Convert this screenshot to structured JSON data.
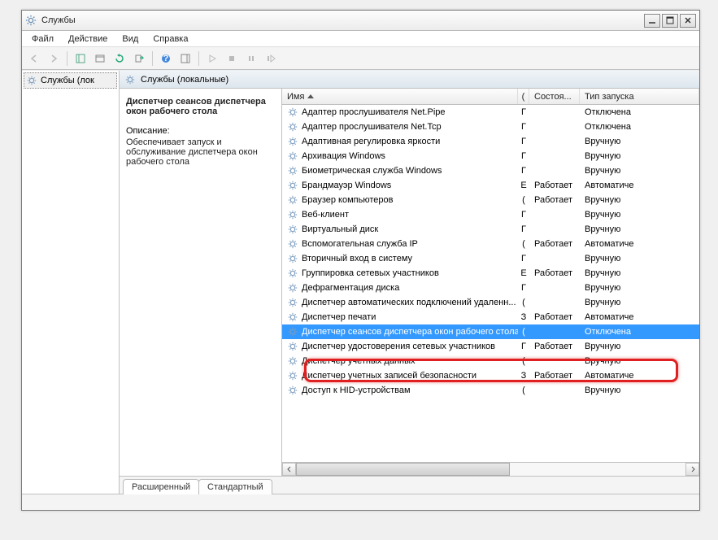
{
  "window": {
    "title": "Службы"
  },
  "menu": {
    "file": "Файл",
    "action": "Действие",
    "view": "Вид",
    "help": "Справка"
  },
  "nav": {
    "services_local_short": "Службы (лок"
  },
  "main": {
    "header": "Службы (локальные)",
    "selected_name": "Диспетчер сеансов диспетчера окон рабочего стола",
    "desc_label": "Описание:",
    "desc_text": "Обеспечивает запуск и обслуживание диспетчера окон рабочего стола"
  },
  "columns": {
    "name": "Имя",
    "desc": "(",
    "state": "Состоя...",
    "startup": "Тип запуска"
  },
  "services": [
    {
      "name": "Адаптер прослушивателя Net.Pipe",
      "d": "Г",
      "state": "",
      "startup": "Отключена"
    },
    {
      "name": "Адаптер прослушивателя Net.Tcp",
      "d": "Г",
      "state": "",
      "startup": "Отключена"
    },
    {
      "name": "Адаптивная регулировка яркости",
      "d": "Г",
      "state": "",
      "startup": "Вручную"
    },
    {
      "name": "Архивация Windows",
      "d": "Г",
      "state": "",
      "startup": "Вручную"
    },
    {
      "name": "Биометрическая служба Windows",
      "d": "Г",
      "state": "",
      "startup": "Вручную"
    },
    {
      "name": "Брандмауэр Windows",
      "d": "Е",
      "state": "Работает",
      "startup": "Автоматиче"
    },
    {
      "name": "Браузер компьютеров",
      "d": "(",
      "state": "Работает",
      "startup": "Вручную"
    },
    {
      "name": "Веб-клиент",
      "d": "Г",
      "state": "",
      "startup": "Вручную"
    },
    {
      "name": "Виртуальный диск",
      "d": "Г",
      "state": "",
      "startup": "Вручную"
    },
    {
      "name": "Вспомогательная служба IP",
      "d": "(",
      "state": "Работает",
      "startup": "Автоматиче"
    },
    {
      "name": "Вторичный вход в систему",
      "d": "Г",
      "state": "",
      "startup": "Вручную"
    },
    {
      "name": "Группировка сетевых участников",
      "d": "Е",
      "state": "Работает",
      "startup": "Вручную"
    },
    {
      "name": "Дефрагментация диска",
      "d": "Г",
      "state": "",
      "startup": "Вручную"
    },
    {
      "name": "Диспетчер автоматических подключений удаленн...",
      "d": "(",
      "state": "",
      "startup": "Вручную"
    },
    {
      "name": "Диспетчер печати",
      "d": "З",
      "state": "Работает",
      "startup": "Автоматиче"
    },
    {
      "name": "Диспетчер сеансов диспетчера окон рабочего стола",
      "d": "(",
      "state": "",
      "startup": "Отключена",
      "selected": true
    },
    {
      "name": "Диспетчер удостоверения сетевых участников",
      "d": "Г",
      "state": "Работает",
      "startup": "Вручную"
    },
    {
      "name": "Диспетчер учетных данных",
      "d": "(",
      "state": "",
      "startup": "Вручную"
    },
    {
      "name": "Диспетчер учетных записей безопасности",
      "d": "З",
      "state": "Работает",
      "startup": "Автоматиче"
    },
    {
      "name": "Доступ к HID-устройствам",
      "d": "(",
      "state": "",
      "startup": "Вручную"
    }
  ],
  "viewtabs": {
    "extended": "Расширенный",
    "standard": "Стандартный"
  }
}
